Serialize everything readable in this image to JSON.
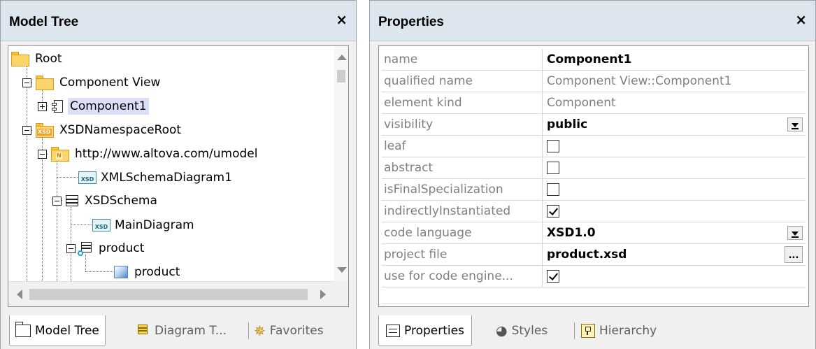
{
  "model_tree_panel": {
    "title": "Model Tree",
    "close_label": "×",
    "nodes": [
      {
        "label": "Root"
      },
      {
        "label": "Component View"
      },
      {
        "label": "Component1"
      },
      {
        "label": "XSDNamespaceRoot",
        "icon_tag": "XSD"
      },
      {
        "label": "http://www.altova.com/umodel",
        "icon_tag": "N"
      },
      {
        "label": "XMLSchemaDiagram1",
        "icon_tag": "XSD"
      },
      {
        "label": "XSDSchema"
      },
      {
        "label": "MainDiagram",
        "icon_tag": "XSD"
      },
      {
        "label": "product"
      },
      {
        "label": "product"
      }
    ],
    "tabs": [
      {
        "label": "Model Tree",
        "icon": "folder-icon",
        "active": true
      },
      {
        "label": "Diagram T...",
        "icon": "diagram-tree-icon",
        "active": false
      },
      {
        "label": "Favorites",
        "icon": "star-icon",
        "active": false
      }
    ]
  },
  "properties_panel": {
    "title": "Properties",
    "close_label": "×",
    "rows": [
      {
        "name": "name",
        "value": "Component1"
      },
      {
        "name": "qualified name",
        "value": "Component View::Component1"
      },
      {
        "name": "element kind",
        "value": "Component"
      },
      {
        "name": "visibility",
        "value": "public"
      },
      {
        "name": "leaf",
        "checked": false
      },
      {
        "name": "abstract",
        "checked": false
      },
      {
        "name": "isFinalSpecialization",
        "checked": false
      },
      {
        "name": "indirectlyInstantiated",
        "checked": true
      },
      {
        "name": "code language",
        "value": "XSD1.0"
      },
      {
        "name": "project file",
        "value": "product.xsd",
        "button_label": "..."
      },
      {
        "name": "use for code engine...",
        "checked": true
      }
    ],
    "tabs": [
      {
        "label": "Properties",
        "icon": "properties-icon",
        "active": true
      },
      {
        "label": "Styles",
        "icon": "palette-icon",
        "active": false
      },
      {
        "label": "Hierarchy",
        "icon": "hierarchy-icon",
        "active": false
      }
    ]
  }
}
